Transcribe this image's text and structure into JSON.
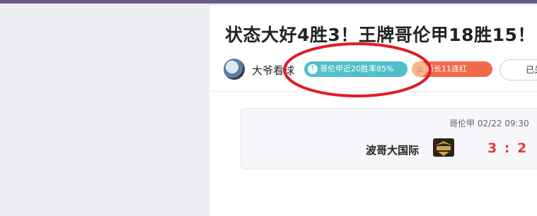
{
  "article": {
    "title": "状态大好4胜3！王牌哥伦甲18胜15！"
  },
  "author": {
    "name": "大爷看球",
    "avatar_icon": "football-avatar-icon",
    "badges": [
      {
        "label": "哥伦甲近20胜率85%",
        "icon": "arrow-up-icon",
        "color": "#4fbfc9"
      },
      {
        "label": "最长11连红",
        "icon": "fire-icon",
        "color": "#f06a4a"
      }
    ],
    "follow_label": "已关注"
  },
  "match": {
    "league_time": "哥伦甲 02/22 09:30",
    "home_team": "波哥大国际",
    "team_logo_icon": "club-crest-icon",
    "score": "3 : 2"
  },
  "annotation": {
    "color": "#e01b24"
  }
}
